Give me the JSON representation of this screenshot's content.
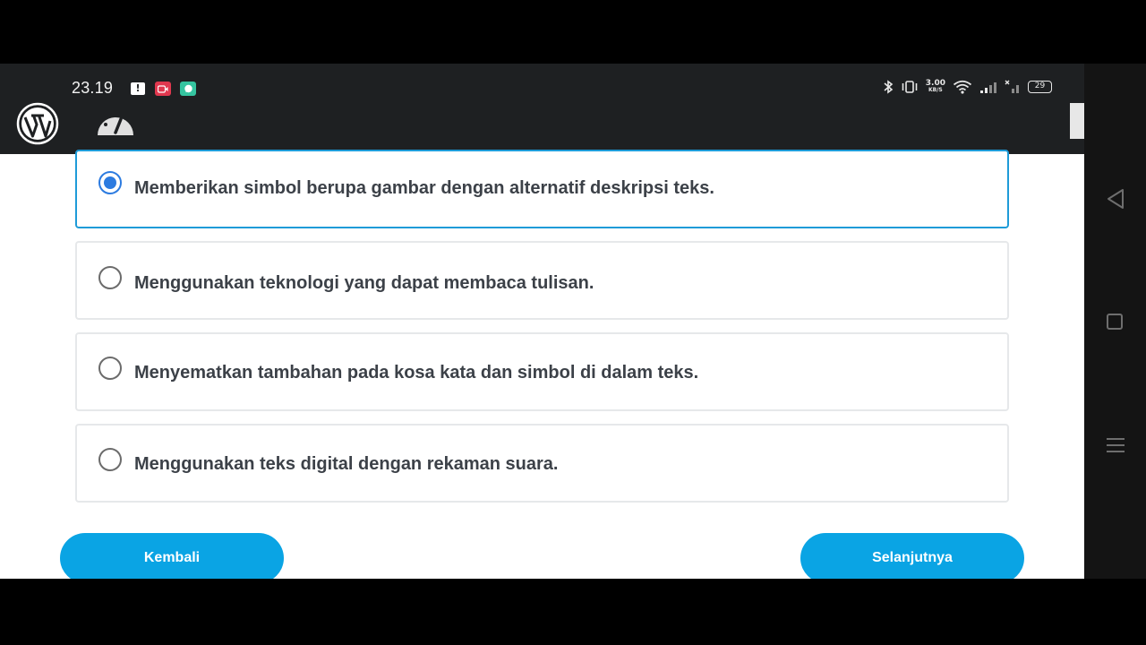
{
  "statusbar": {
    "time": "23.19",
    "network_speed_value": "3.00",
    "network_speed_unit": "KB/S",
    "battery": "29",
    "icons": [
      "message-notification-icon",
      "screen-record-icon",
      "chat-app-icon",
      "bluetooth-icon",
      "vibrate-icon",
      "wifi-icon",
      "signal-icon",
      "no-sim-signal-icon",
      "battery-icon"
    ]
  },
  "appbar": {
    "icons": [
      "wordpress-logo-icon",
      "dashboard-gauge-icon"
    ]
  },
  "quiz": {
    "options": [
      {
        "label": "Memberikan simbol berupa gambar dengan alternatif deskripsi teks.",
        "selected": true
      },
      {
        "label": "Menggunakan teknologi yang dapat membaca tulisan.",
        "selected": false
      },
      {
        "label": "Menyematkan tambahan pada kosa kata dan simbol di dalam teks.",
        "selected": false
      },
      {
        "label": "Menggunakan teks digital dengan rekaman suara.",
        "selected": false
      }
    ]
  },
  "buttons": {
    "back_label": "Kembali",
    "next_label": "Selanjutnya"
  },
  "colors": {
    "accent": "#0aa4e4",
    "selected_border": "#1e9bd8",
    "radio_checked": "#2c7be0",
    "statusbar_bg": "#1e2022"
  }
}
